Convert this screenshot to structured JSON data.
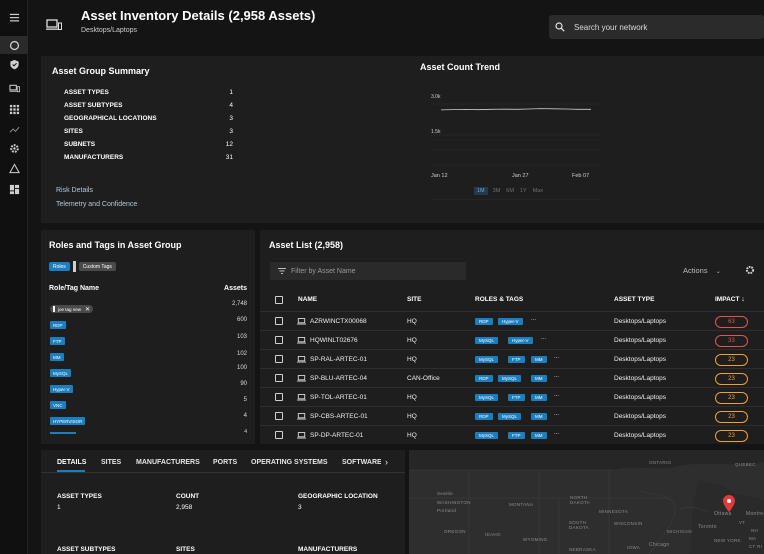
{
  "header": {
    "title": "Asset Inventory Details (2,958 Assets)",
    "subtitle": "Desktops/Laptops"
  },
  "search": {
    "placeholder": "Search your network"
  },
  "sidebar": {
    "items": [
      "menu-icon",
      "dashboard-icon",
      "shield-icon",
      "devices-icon",
      "apps-icon",
      "trend-icon",
      "settings-icon",
      "warning-icon",
      "widgets-icon"
    ]
  },
  "summary": {
    "title": "Asset Group Summary",
    "rows": [
      {
        "label": "ASSET TYPES",
        "value": "1"
      },
      {
        "label": "ASSET SUBTYPES",
        "value": "4"
      },
      {
        "label": "GEOGRAPHICAL LOCATIONS",
        "value": "3"
      },
      {
        "label": "SITES",
        "value": "3"
      },
      {
        "label": "SUBNETS",
        "value": "12"
      },
      {
        "label": "MANUFACTURERS",
        "value": "31"
      }
    ],
    "links": [
      "Risk Details",
      "Telemetry and Confidence"
    ]
  },
  "trend": {
    "title": "Asset Count Trend",
    "ranges": [
      "1M",
      "3M",
      "6M",
      "1Y",
      "Max"
    ],
    "selected_range": "1M"
  },
  "chart_data": {
    "type": "line",
    "title": "Asset Count Trend",
    "x_ticks": [
      "Jan 12",
      "Jan 27",
      "Feb 07"
    ],
    "y_ticks": [
      "3.0k",
      "1.5k"
    ],
    "ylim": [
      0,
      3000
    ],
    "series": [
      {
        "values": [
          2940,
          2950,
          2955,
          2948,
          2960,
          2965,
          2958,
          2970,
          2980,
          2975,
          2968,
          2960,
          2958
        ]
      }
    ]
  },
  "roles": {
    "title": "Roles and Tags in Asset Group",
    "toggle": [
      "Roles",
      "Custom Tags"
    ],
    "col_name": "Role/Tag Name",
    "col_assets": "Assets",
    "items": [
      {
        "name": "joe tag new",
        "count": "2,748",
        "removable": true
      },
      {
        "name": "RDP",
        "count": "600"
      },
      {
        "name": "FTP",
        "count": "103"
      },
      {
        "name": "MM",
        "count": "102"
      },
      {
        "name": "MySQL",
        "count": "100"
      },
      {
        "name": "Hyper-V",
        "count": "90"
      },
      {
        "name": "VNC",
        "count": "5"
      },
      {
        "name": "HYPERVISOR",
        "count": "4"
      },
      {
        "name": "",
        "count": "4"
      }
    ]
  },
  "assets": {
    "title": "Asset List (2,958)",
    "filter_placeholder": "Filter by Asset Name",
    "actions_label": "Actions",
    "columns": [
      "NAME",
      "SITE",
      "ROLES & TAGS",
      "ASSET TYPE",
      "IMPACT"
    ],
    "rows": [
      {
        "name": "AZRWINCTX00068",
        "site": "HQ",
        "tags": [
          "RDP",
          "Hyper-V"
        ],
        "more": "...",
        "type": "Desktops/Laptops",
        "impact": "63",
        "level": "red"
      },
      {
        "name": "HQWINLT02676",
        "site": "HQ",
        "tags": [
          "MySQL",
          "Hyper-V"
        ],
        "more": "...",
        "type": "Desktops/Laptops",
        "impact": "33",
        "level": "red"
      },
      {
        "name": "SP-RAL-ARTEC-01",
        "site": "HQ",
        "tags": [
          "MySQL",
          "FTP",
          "MM"
        ],
        "more": "...",
        "type": "Desktops/Laptops",
        "impact": "23",
        "level": "orange"
      },
      {
        "name": "SP-BLU-ARTEC-04",
        "site": "CAN-Office",
        "tags": [
          "RDP",
          "MySQL",
          "MM"
        ],
        "more": "...",
        "type": "Desktops/Laptops",
        "impact": "23",
        "level": "orange"
      },
      {
        "name": "SP-TOL-ARTEC-01",
        "site": "HQ",
        "tags": [
          "MySQL",
          "FTP",
          "MM"
        ],
        "more": "...",
        "type": "Desktops/Laptops",
        "impact": "23",
        "level": "orange"
      },
      {
        "name": "SP-CBS-ARTEC-01",
        "site": "HQ",
        "tags": [
          "RDP",
          "MySQL",
          "MM"
        ],
        "more": "...",
        "type": "Desktops/Laptops",
        "impact": "23",
        "level": "orange"
      },
      {
        "name": "SP-DP-ARTEC-01",
        "site": "HQ",
        "tags": [
          "MySQL",
          "FTP",
          "MM"
        ],
        "more": "...",
        "type": "Desktops/Laptops",
        "impact": "23",
        "level": "orange"
      }
    ]
  },
  "details": {
    "tabs": [
      "DETAILS",
      "SITES",
      "MANUFACTURERS",
      "PORTS",
      "OPERATING SYSTEMS",
      "SOFTWARE"
    ],
    "active_tab": "DETAILS",
    "fields": [
      {
        "label": "ASSET TYPES",
        "value": "1"
      },
      {
        "label": "COUNT",
        "value": "2,958"
      },
      {
        "label": "GEOGRAPHIC LOCATION",
        "value": "3"
      },
      {
        "label": "ASSET SUBTYPES",
        "value": ""
      },
      {
        "label": "SITES",
        "value": ""
      },
      {
        "label": "MANUFACTURERS",
        "value": ""
      }
    ]
  },
  "map": {
    "labels": [
      "ONTARIO",
      "QUEBEC",
      "Seattle",
      "WASHINGTON",
      "Portland",
      "MONTANA",
      "NORTH DAKOTA",
      "MINNESOTA",
      "OREGON",
      "IDAHO",
      "WYOMING",
      "SOUTH DAKOTA",
      "WISCONSIN",
      "MICHIGAN",
      "Ottawa",
      "Montre",
      "Toronto",
      "VT",
      "NH",
      "NEW YORK",
      "MA",
      "CT RI",
      "Chicago",
      "IOWA",
      "NEBRASKA"
    ],
    "pin_color": "#e0393e"
  }
}
